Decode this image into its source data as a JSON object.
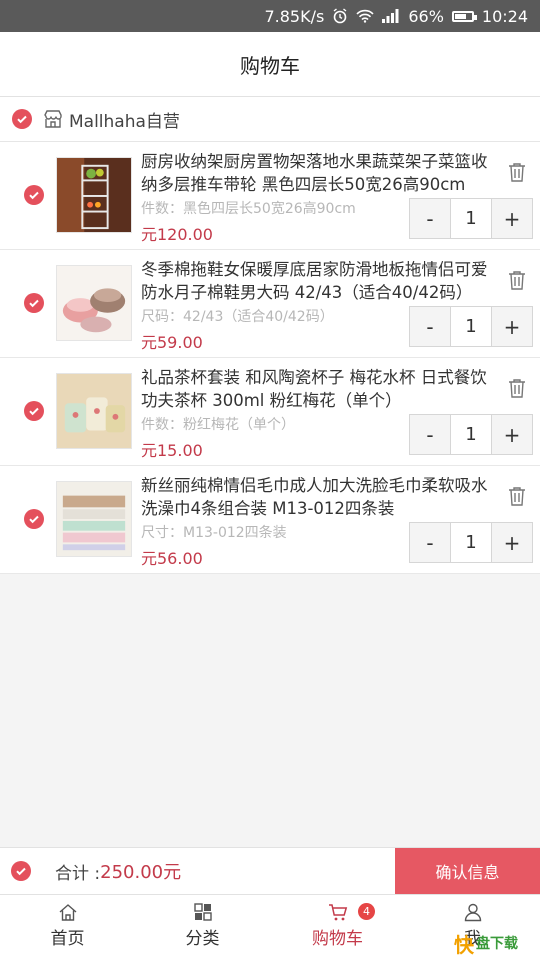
{
  "status": {
    "speed": "7.85K/s",
    "battery": "66%",
    "battery_level": 0.66,
    "time": "10:24"
  },
  "header": {
    "title": "购物车"
  },
  "shop": {
    "name": "Mallhaha自营"
  },
  "items": [
    {
      "name": "厨房收纳架厨房置物架落地水果蔬菜架子菜篮收纳多层推车带轮 黑色四层长50宽26高90cm",
      "spec": "件数：黑色四层长50宽26高90cm",
      "price": "元120.00",
      "qty": "1"
    },
    {
      "name": "冬季棉拖鞋女保暖厚底居家防滑地板拖情侣可爱防水月子棉鞋男大码 42/43（适合40/42码）",
      "spec": "尺码：42/43（适合40/42码）",
      "price": "元59.00",
      "qty": "1"
    },
    {
      "name": "礼品茶杯套装 和风陶瓷杯子 梅花水杯 日式餐饮功夫茶杯 300ml 粉红梅花（单个）",
      "spec": "件数：粉红梅花（单个）",
      "price": "元15.00",
      "qty": "1"
    },
    {
      "name": "新丝丽纯棉情侣毛巾成人加大洗脸毛巾柔软吸水洗澡巾4条组合装 M13-012四条装",
      "spec": "尺寸：M13-012四条装",
      "price": "元56.00",
      "qty": "1"
    }
  ],
  "stepper": {
    "minus": "-",
    "plus": "+"
  },
  "footer": {
    "total_label": "合计 :",
    "total_value": "250.00元",
    "confirm_label": "确认信息"
  },
  "tabs": [
    {
      "label": "首页",
      "icon": "home-icon"
    },
    {
      "label": "分类",
      "icon": "category-icon"
    },
    {
      "label": "购物车",
      "icon": "cart-icon",
      "badge": "4"
    },
    {
      "label": "我",
      "icon": "person-icon"
    }
  ],
  "watermark": {
    "brand": "快",
    "text": "盘下载"
  },
  "colors": {
    "accent": "#e4505c",
    "price": "#c33a4a",
    "confirm": "#e65863"
  }
}
